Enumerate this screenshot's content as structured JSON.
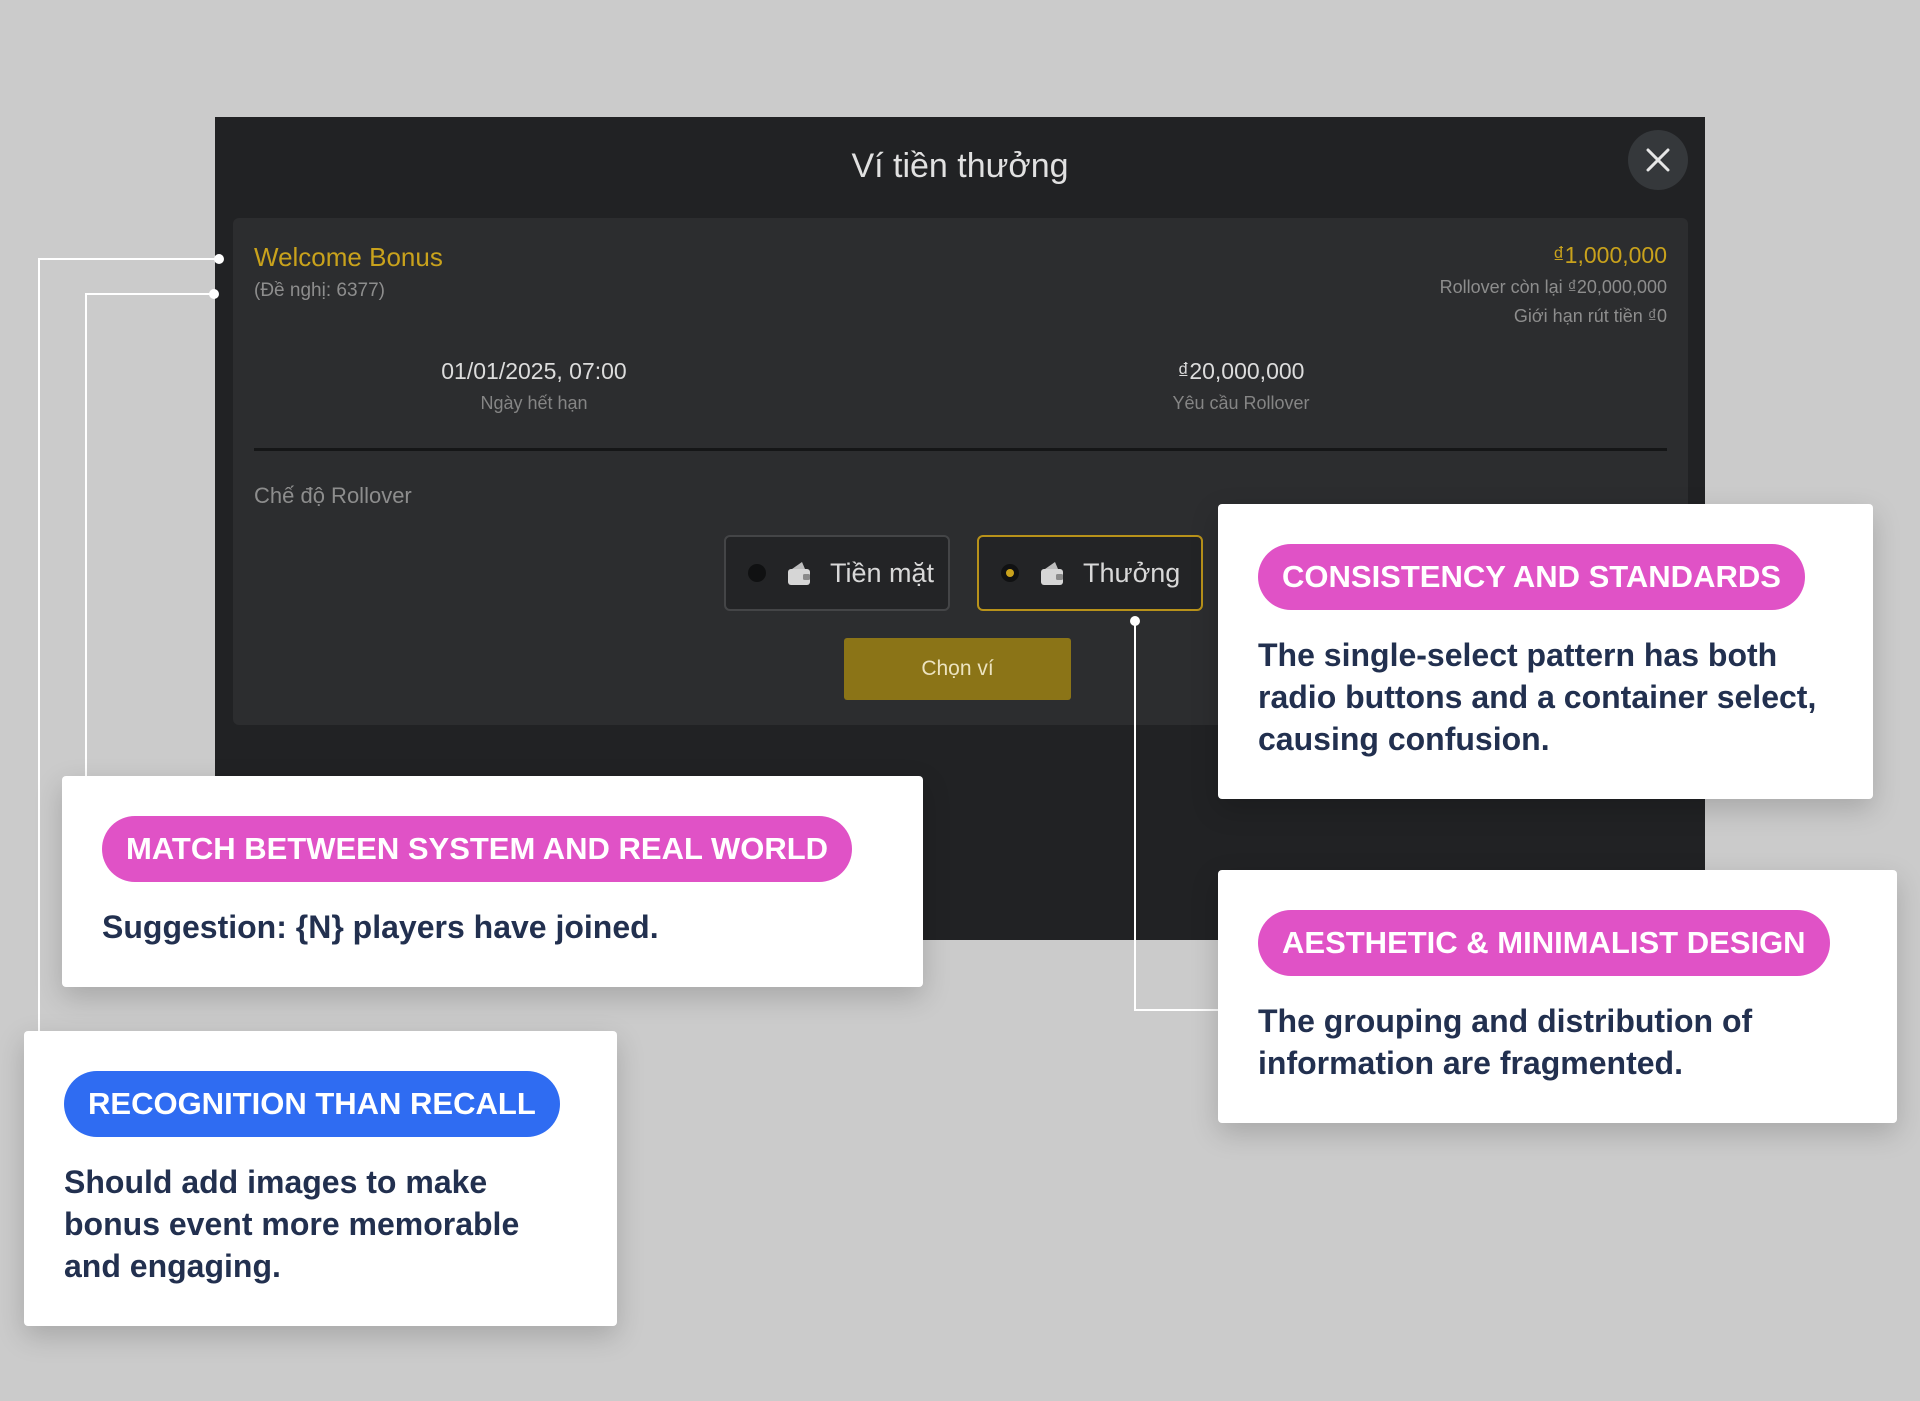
{
  "modal": {
    "title": "Ví tiền thưởng",
    "bonus": {
      "name": "Welcome Bonus",
      "offer": "(Đề nghị: 6377)",
      "amount": "₫1,000,000",
      "rollover_remaining": "Rollover còn lại ₫20,000,000",
      "withdraw_limit": "Giới hạn rút tiền ₫0"
    },
    "expiry": {
      "value": "01/01/2025, 07:00",
      "label": "Ngày hết hạn"
    },
    "rollover_req": {
      "value": "₫20,000,000",
      "label": "Yêu cầu Rollover"
    },
    "mode_label": "Chế độ Rollover",
    "options": [
      {
        "label": "Tiền mặt",
        "selected": false
      },
      {
        "label": "Thưởng",
        "selected": true
      }
    ],
    "choose_button": "Chọn ví"
  },
  "annotations": {
    "consistency": {
      "tag": "CONSISTENCY AND STANDARDS",
      "text": "The single-select pattern has both radio buttons and a container select, causing confusion."
    },
    "match": {
      "tag": "MATCH BETWEEN SYSTEM AND REAL WORLD",
      "text": "Suggestion: {N} players have joined."
    },
    "aesthetic": {
      "tag": "AESTHETIC & MINIMALIST DESIGN",
      "text": "The grouping and distribution of information are fragmented."
    },
    "recognition": {
      "tag": "RECOGNITION THAN RECALL",
      "text": "Should add images to make bonus event more memorable and engaging."
    }
  },
  "colors": {
    "accent_gold": "#c9a21c",
    "tag_pink": "#e052c6",
    "tag_blue": "#2f6cf2",
    "note_text": "#22304f"
  }
}
